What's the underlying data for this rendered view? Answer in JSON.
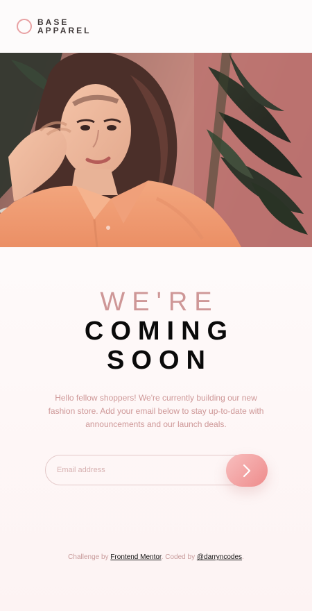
{
  "brand": {
    "line1": "BASE",
    "line2": "APPAREL",
    "accent_color": "#E8A1A3"
  },
  "hero": {
    "image_alt": "Woman in an orange shirt in front of leaves"
  },
  "headline": {
    "light": "WE'RE",
    "line2": "COMING",
    "line3": "SOON"
  },
  "description": "Hello fellow shoppers! We're currently building our new fashion store. Add your email below to stay up-to-date with announcements and our launch deals.",
  "form": {
    "email_placeholder": "Email address",
    "submit_icon": "chevron-right-icon"
  },
  "footer": {
    "challenge_prefix": "Challenge by",
    "challenge_link": "Frontend Mentor",
    "coded_by_prefix": ". Coded by",
    "author_link": "@darryncodes",
    "suffix": "."
  }
}
